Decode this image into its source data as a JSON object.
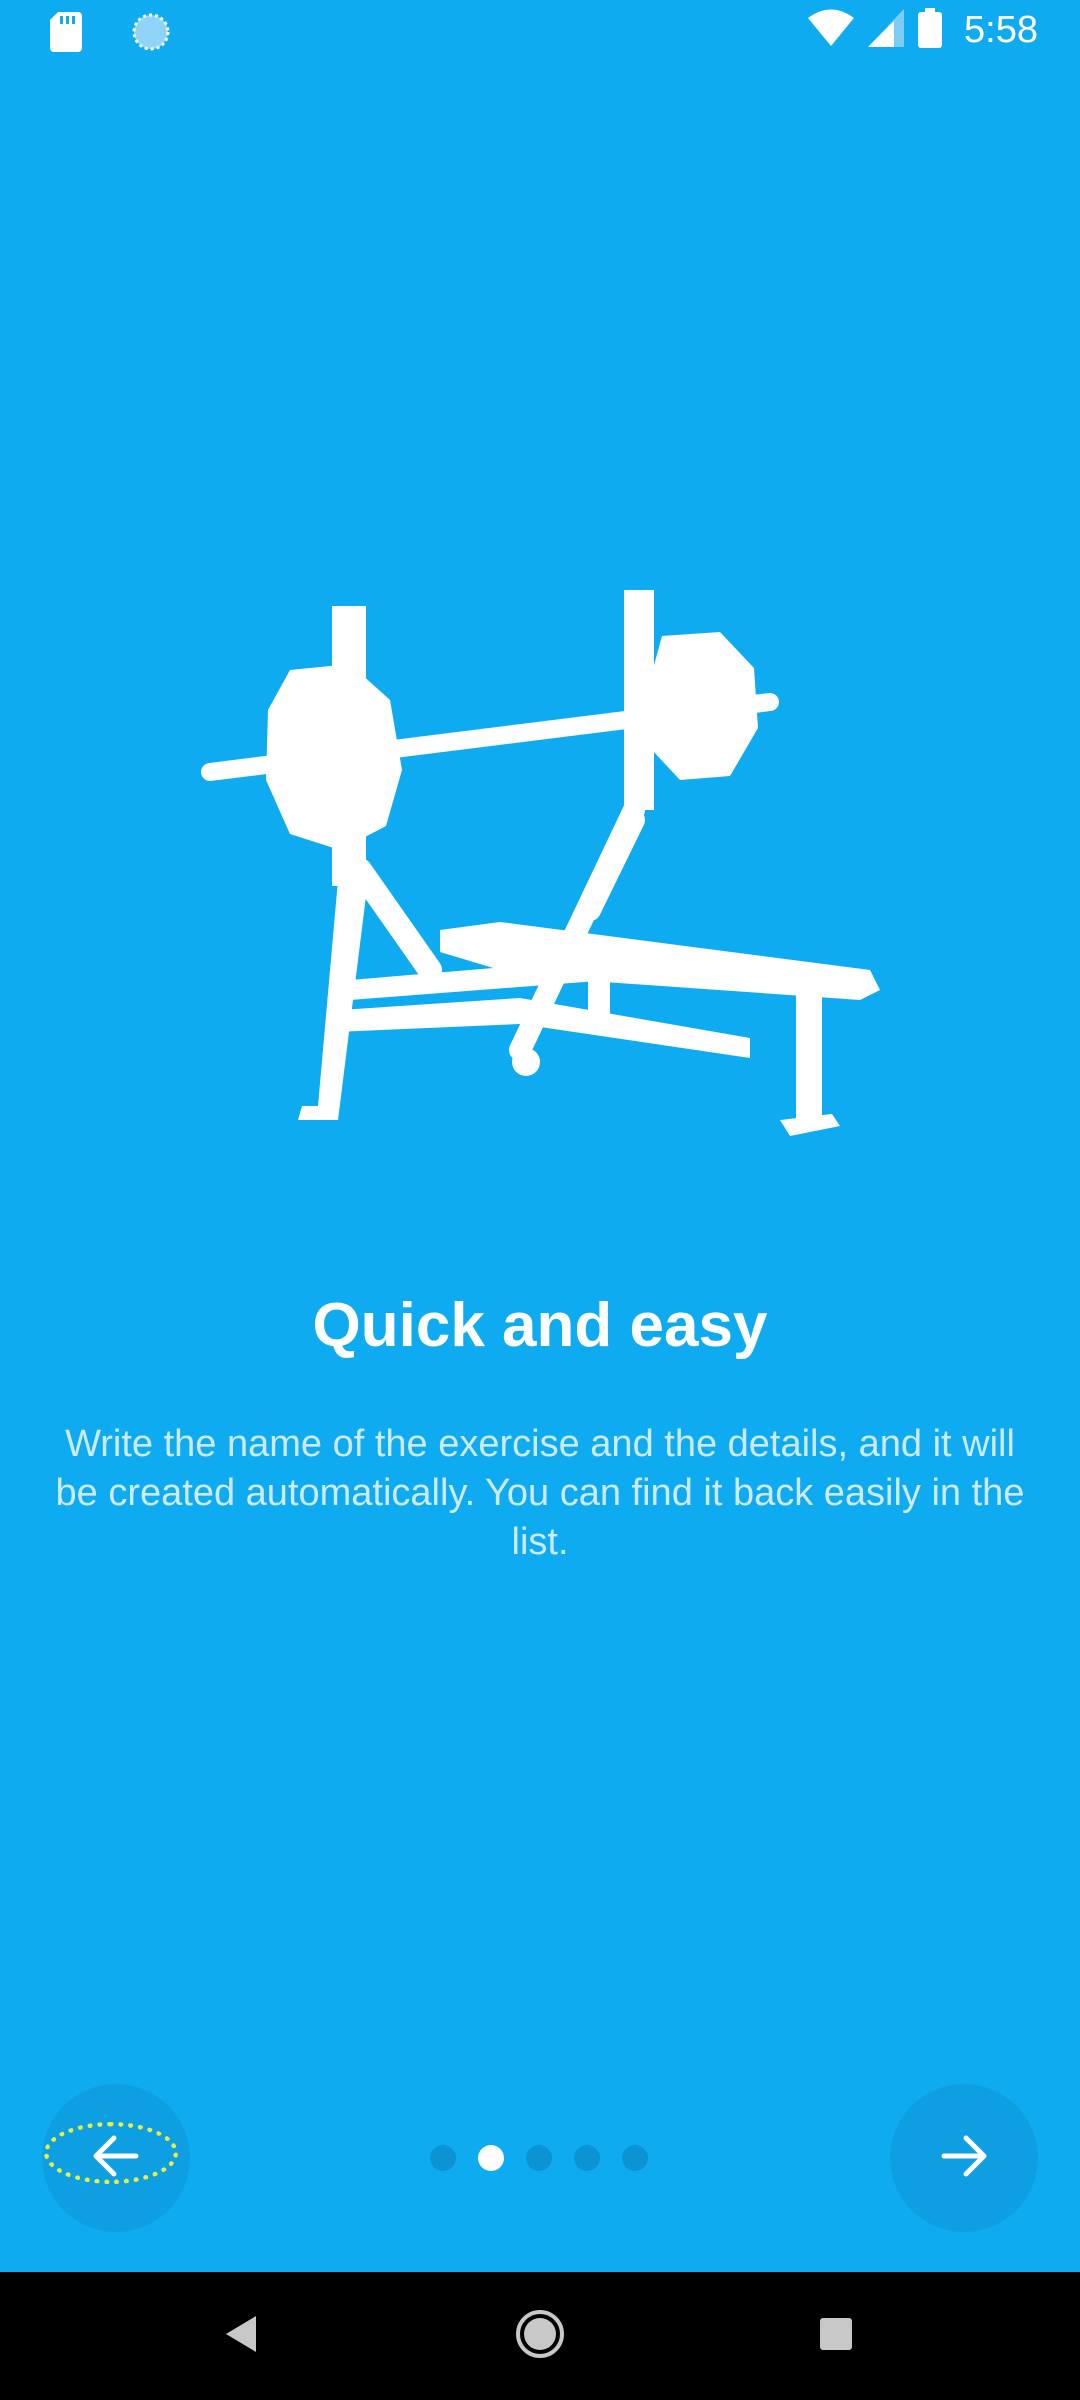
{
  "status_bar": {
    "time": "5:58",
    "left_icons": [
      "sd-card-icon",
      "sync-icon"
    ],
    "right_icons": [
      "wifi-icon",
      "cell-signal-icon",
      "battery-icon"
    ]
  },
  "onboarding": {
    "illustration": "bench-press-icon",
    "title": "Quick and easy",
    "description": "Write the name of the exercise and the details, and it will be created automatically. You can find it back easily in the list.",
    "page_count": 5,
    "current_page": 2
  },
  "controls": {
    "back_icon": "arrow-left-icon",
    "next_icon": "arrow-right-icon"
  },
  "system_nav": {
    "icons": [
      "back-triangle-icon",
      "home-circle-icon",
      "recents-square-icon"
    ]
  },
  "colors": {
    "background": "#0fabf1",
    "button_bg": "#0e9fe3",
    "dot_inactive": "#0b93d3",
    "dot_active": "#ffffff",
    "focus_ring": "#e9f044"
  }
}
